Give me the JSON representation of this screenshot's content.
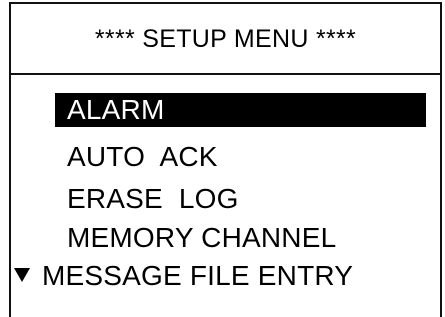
{
  "header": {
    "title": "**** SETUP MENU ****"
  },
  "menu": {
    "items": [
      {
        "label": "ALARM",
        "selected": true
      },
      {
        "label": "AUTO  ACK",
        "selected": false
      },
      {
        "label": "ERASE  LOG",
        "selected": false
      },
      {
        "label": "MEMORY CHANNEL",
        "selected": false
      },
      {
        "label": "MESSAGE FILE ENTRY",
        "selected": false
      }
    ],
    "more_indicator_icon": "triangle-down-icon"
  },
  "colors": {
    "selection_background": "#000000",
    "selection_text": "#ffffff",
    "text": "#000000",
    "background": "#ffffff"
  }
}
